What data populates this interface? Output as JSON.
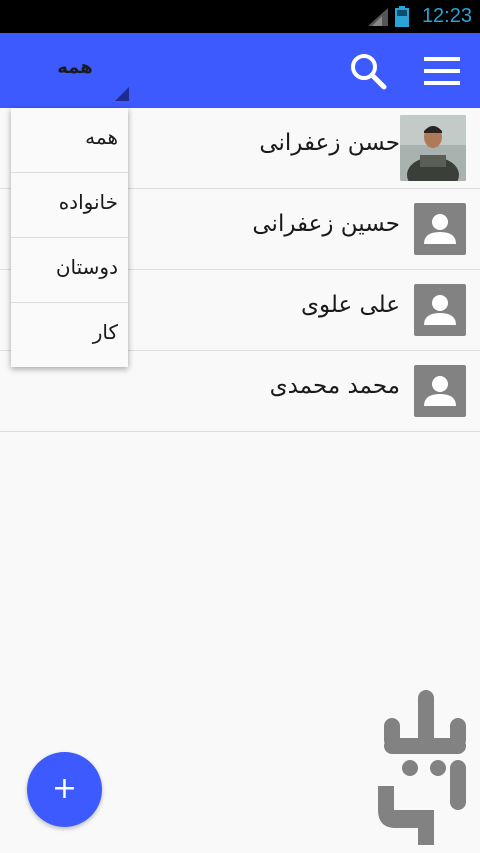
{
  "status_bar": {
    "time": "12:23",
    "accent_color": "#2aa3d8",
    "icons": [
      "signal-icon",
      "battery-icon"
    ]
  },
  "app_bar": {
    "background": "#3d5afe",
    "filter_value": "همه",
    "icons": [
      "menu-icon",
      "search-icon",
      "dropdown-caret-icon"
    ]
  },
  "filter_options": [
    "همه",
    "خانواده",
    "دوستان",
    "کار"
  ],
  "contacts": [
    {
      "name": "حسن زعفرانی",
      "avatar": "photo"
    },
    {
      "name": "حسین زعفرانی",
      "avatar": "person-icon"
    },
    {
      "name": "علی علوی",
      "avatar": "person-icon"
    },
    {
      "name": "محمد محمدی",
      "avatar": "person-icon"
    }
  ],
  "fab": {
    "label": "+",
    "icon": "add-icon"
  },
  "watermark": {
    "name": "store-logo",
    "color": "#3a3a3a"
  }
}
